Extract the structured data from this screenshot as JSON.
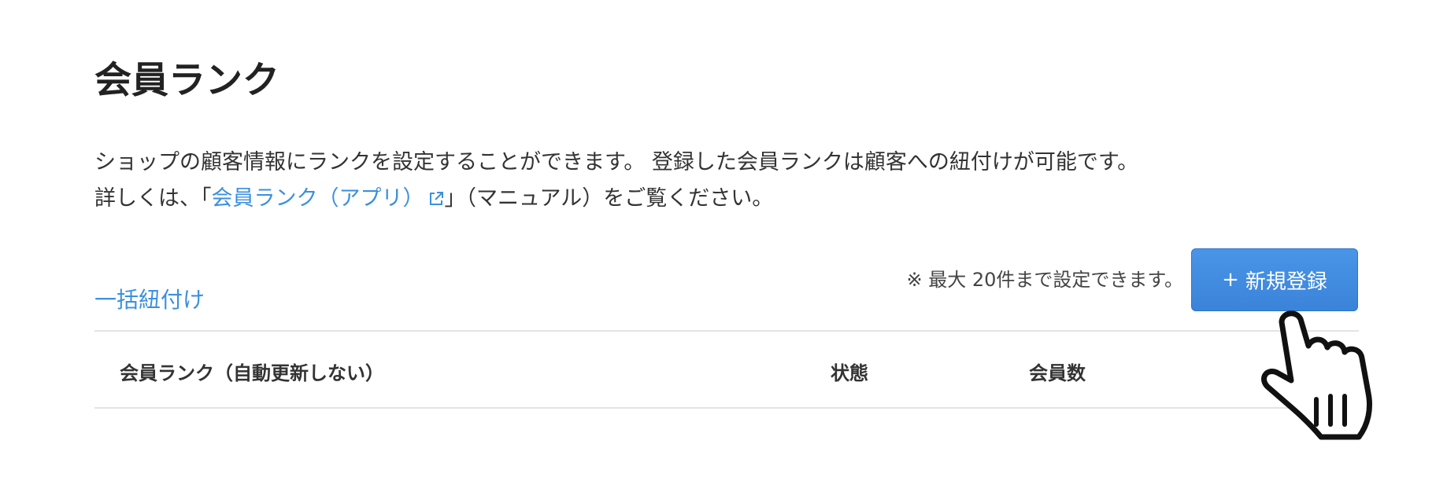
{
  "page": {
    "title": "会員ランク"
  },
  "description": {
    "line1": "ショップの顧客情報にランクを設定することができます。 登録した会員ランクは顧客への紐付けが可能です。",
    "line2_prefix": "詳しくは、「",
    "line2_link": "会員ランク（アプリ）",
    "line2_suffix": "」（マニュアル）をご覧ください。"
  },
  "toolbar": {
    "bulk_link_label": "一括紐付け",
    "limit_note": "※ 最大 20件まで設定できます。",
    "new_button_plus": "+",
    "new_button_label": "新規登録"
  },
  "table": {
    "columns": [
      "会員ランク（自動更新しない）",
      "状態",
      "会員数"
    ]
  },
  "colors": {
    "link": "#3b8fe0",
    "primary_button": "#3a83d9",
    "divider": "#e4e4e4"
  },
  "icons": {
    "external_link": "external-link-icon",
    "cursor": "hand-pointer-cursor-icon"
  }
}
